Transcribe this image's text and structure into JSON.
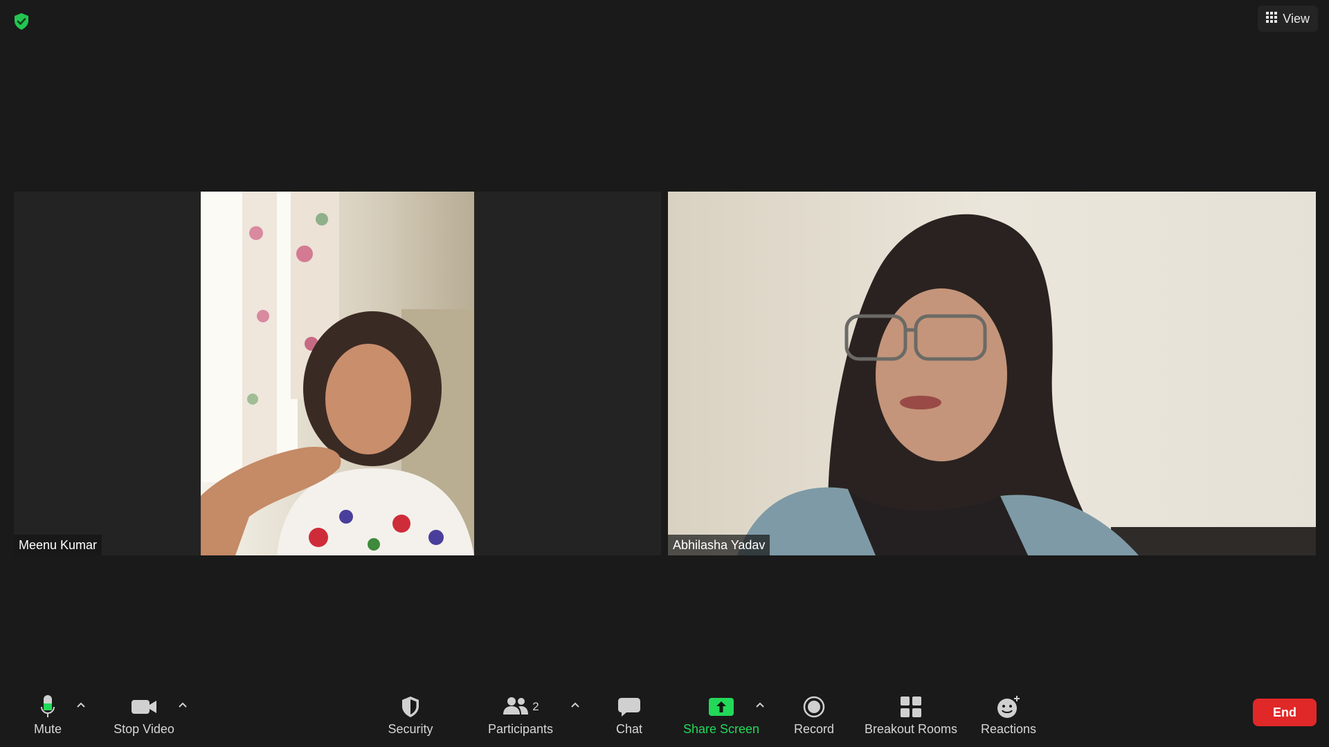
{
  "app": {
    "view_label": "View",
    "colors": {
      "background": "#1a1a1a",
      "accent_green": "#23d959",
      "end_red": "#e02828",
      "shield_green": "#23c552"
    }
  },
  "participants": [
    {
      "name": "Meenu Kumar"
    },
    {
      "name": "Abhilasha Yadav"
    }
  ],
  "toolbar": {
    "mute_label": "Mute",
    "stop_video_label": "Stop Video",
    "security_label": "Security",
    "participants_label": "Participants",
    "participants_count": "2",
    "chat_label": "Chat",
    "share_screen_label": "Share Screen",
    "record_label": "Record",
    "breakout_rooms_label": "Breakout Rooms",
    "reactions_label": "Reactions",
    "end_label": "End"
  },
  "icons": [
    "shield-check-icon",
    "grid-view-icon",
    "microphone-icon",
    "video-camera-icon",
    "shield-icon",
    "people-icon",
    "chat-bubble-icon",
    "share-screen-icon",
    "record-icon",
    "breakout-rooms-icon",
    "emoji-plus-icon",
    "chevron-up-icon"
  ]
}
